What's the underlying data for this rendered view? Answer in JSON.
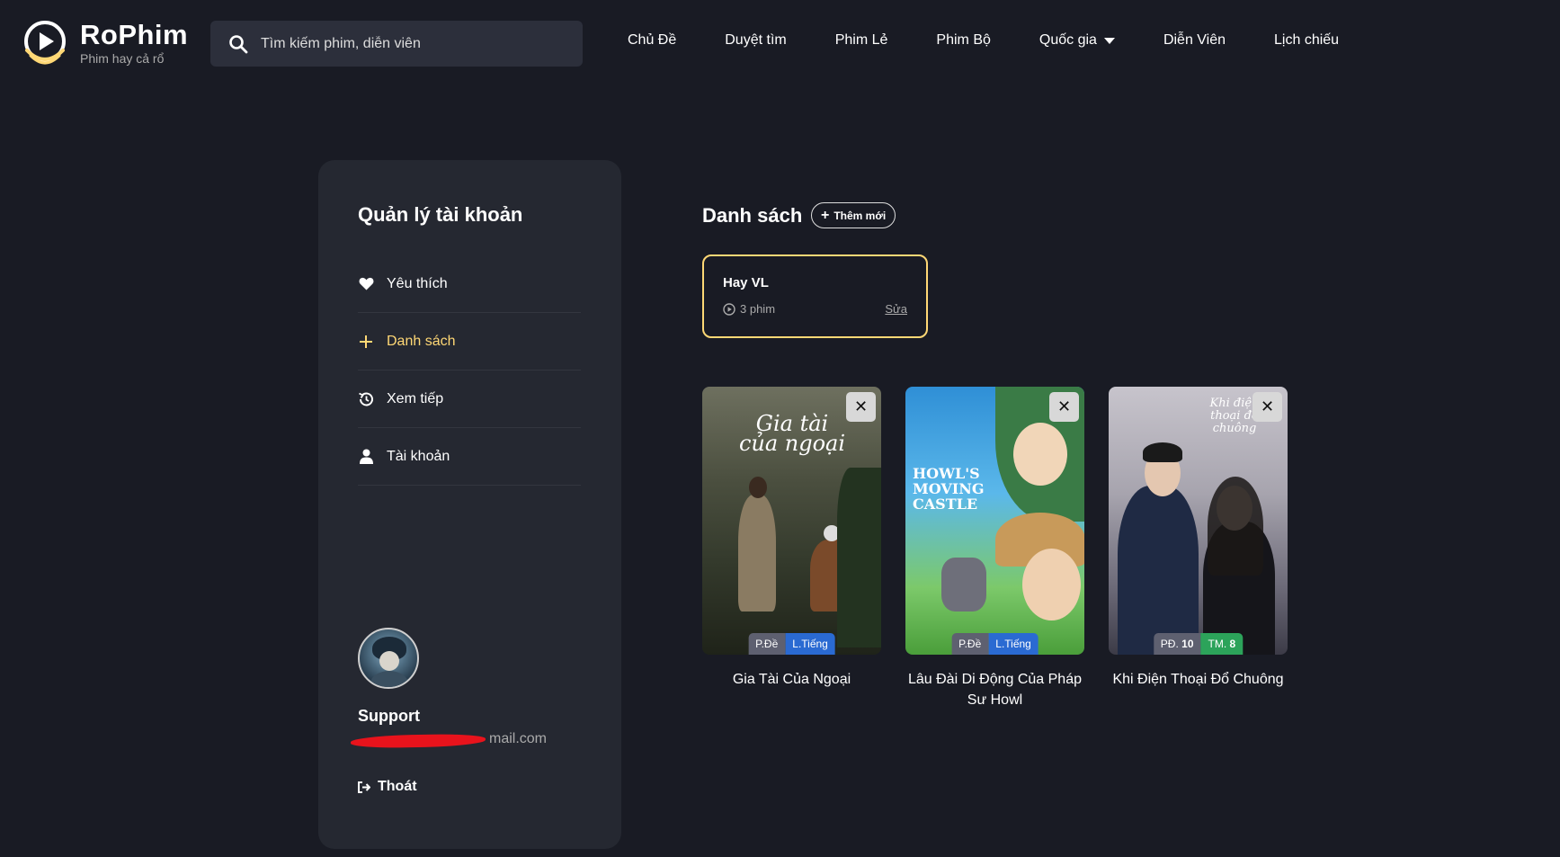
{
  "header": {
    "logo": {
      "name": "RoPhim",
      "tagline": "Phim hay cả rổ"
    },
    "search": {
      "placeholder": "Tìm kiếm phim, diễn viên",
      "value": ""
    },
    "nav": [
      {
        "label": "Chủ Đề"
      },
      {
        "label": "Duyệt tìm"
      },
      {
        "label": "Phim Lẻ"
      },
      {
        "label": "Phim Bộ"
      },
      {
        "label": "Quốc gia"
      },
      {
        "label": "Diễn Viên"
      },
      {
        "label": "Lịch chiếu"
      }
    ]
  },
  "sidebar": {
    "title": "Quản lý tài khoản",
    "menu": [
      {
        "label": "Yêu thích",
        "icon": "heart-icon"
      },
      {
        "label": "Danh sách",
        "icon": "plus-icon",
        "active": true
      },
      {
        "label": "Xem tiếp",
        "icon": "history-icon"
      },
      {
        "label": "Tài khoản",
        "icon": "user-icon"
      }
    ],
    "profile": {
      "name": "Support",
      "email_visible": "mail.com"
    },
    "logout": "Thoát"
  },
  "main": {
    "title": "Danh sách",
    "add_button": "Thêm mới",
    "list": {
      "name": "Hay VL",
      "count": "3 phim",
      "edit": "Sửa"
    },
    "movies": [
      {
        "title": "Gia Tài Của Ngoại",
        "poster_text": "Gia tài của ngoại",
        "badges": [
          {
            "text": "P.Đề",
            "color": "gray"
          },
          {
            "text": "L.Tiếng",
            "color": "blue"
          }
        ]
      },
      {
        "title": "Lâu Đài Di Động Của Pháp Sư Howl",
        "poster_text": "HOWL'S MOVING CASTLE",
        "badges": [
          {
            "text": "P.Đề",
            "color": "gray"
          },
          {
            "text": "L.Tiếng",
            "color": "blue"
          }
        ]
      },
      {
        "title": "Khi Điện Thoại Đổ Chuông",
        "poster_text": "Khi điện thoại đổ chuông",
        "badges": [
          {
            "text_prefix": "PĐ.",
            "text_value": "10",
            "color": "gray"
          },
          {
            "text_prefix": "TM.",
            "text_value": "8",
            "color": "green"
          }
        ]
      }
    ]
  },
  "colors": {
    "background": "#191b24",
    "accent": "#ffd875",
    "panel": "#252831"
  }
}
